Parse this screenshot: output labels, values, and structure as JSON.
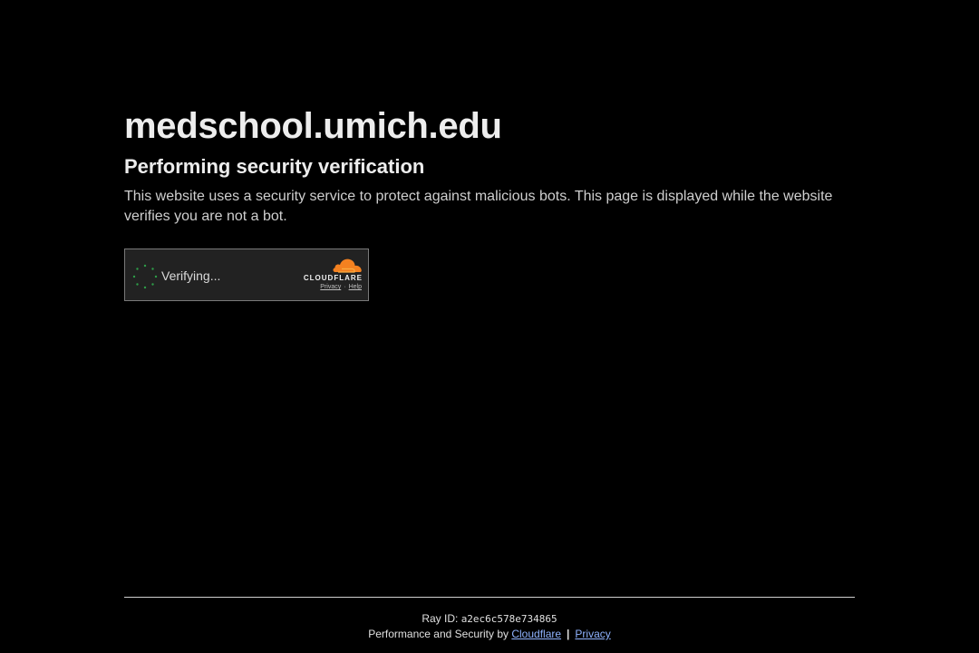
{
  "site": {
    "title": "medschool.umich.edu",
    "subtitle": "Performing security verification",
    "description": "This website uses a security service to protect against malicious bots. This page is displayed while the website verifies you are not a bot."
  },
  "widget": {
    "status": "Verifying...",
    "brand": "CLOUDFLARE",
    "privacy_link": "Privacy",
    "separator": "·",
    "help_link": "Help",
    "spinner_color": "#2e9e48",
    "cloud_color": "#f48120"
  },
  "footer": {
    "ray_label": "Ray ID:",
    "ray_id": "a2ec6c578e734865",
    "performance_text": "Performance and Security by",
    "cloudflare_link": "Cloudflare",
    "divider": "|",
    "privacy_link": "Privacy",
    "link_color": "#8fb3ff"
  }
}
